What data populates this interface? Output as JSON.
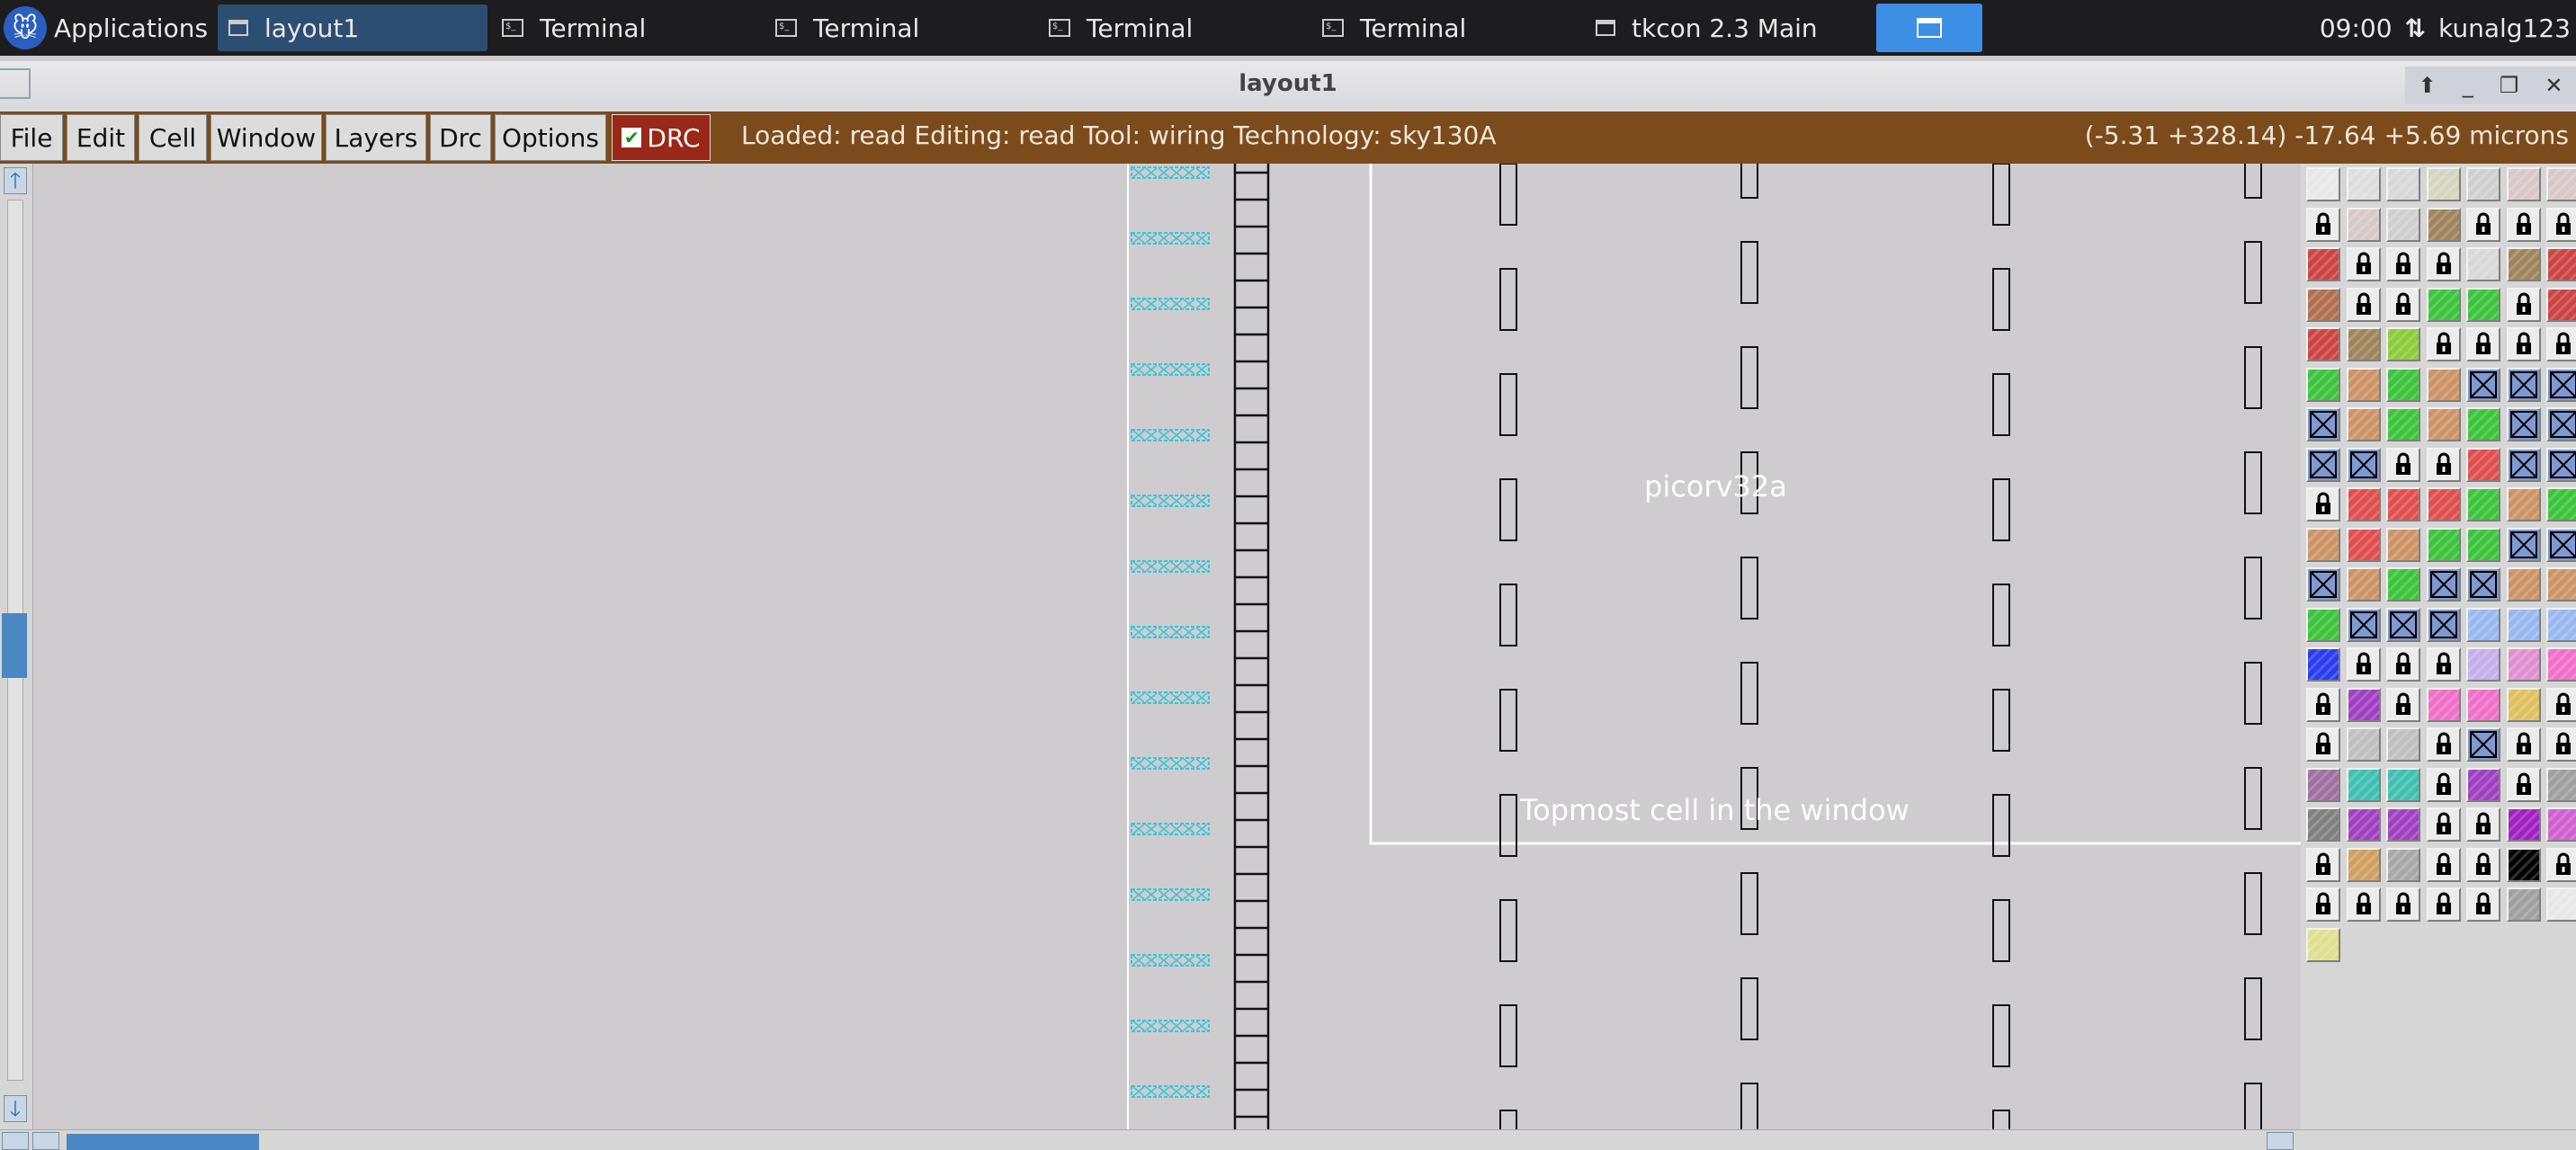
{
  "taskbar": {
    "apps_label": "Applications",
    "tasks": [
      {
        "label": "layout1",
        "icon": "window-icon",
        "active": true
      },
      {
        "label": "Terminal",
        "icon": "terminal-icon",
        "active": false
      },
      {
        "label": "Terminal",
        "icon": "terminal-icon",
        "active": false
      },
      {
        "label": "Terminal",
        "icon": "terminal-icon",
        "active": false
      },
      {
        "label": "Terminal",
        "icon": "terminal-icon",
        "active": false
      },
      {
        "label": "tkcon 2.3 Main",
        "icon": "window-icon",
        "active": false
      }
    ],
    "clock": "09:00",
    "network_icon": "network-updown-icon",
    "user": "kunalg123"
  },
  "window": {
    "title": "layout1",
    "controls": [
      "up-icon",
      "minimize-icon",
      "restore-icon",
      "close-icon"
    ]
  },
  "menubar": {
    "items": [
      "File",
      "Edit",
      "Cell",
      "Window",
      "Layers",
      "Drc",
      "Options"
    ],
    "drc_label": "DRC",
    "drc_checked": true,
    "status": "Loaded: read  Editing: read  Tool: wiring   Technology: sky130A",
    "coords": "(-5.31 +328.14) -17.64 +5.69 microns"
  },
  "canvas": {
    "cell_name": "picorv32a",
    "box_label": "Topmost cell in the window",
    "background": "#cfcccf"
  },
  "palette": {
    "rows": [
      [
        "#e8e8e8g",
        "#dededeY",
        "#d8d8d8F",
        "#d6d6c0",
        "#cfcfcfH",
        "#d8c8c8",
        "#d8c8c8"
      ],
      [
        "L",
        "#d8c8c8",
        "#cfcfcfH",
        "#a0845c",
        "L",
        "L",
        "L"
      ],
      [
        "#cc4444",
        "L",
        "L",
        "L",
        "#d8d8d8",
        "#a0845c",
        "#cc4444"
      ],
      [
        "#b07050",
        "L",
        "L",
        "#3cc43c",
        "#3cc43c",
        "L",
        "#cc4444"
      ],
      [
        "#cc4444",
        "#a0845c",
        "#8ccc3c",
        "L",
        "L",
        "L",
        "L"
      ],
      [
        "#3cc43c",
        "#cc9466",
        "#3cc43c",
        "#cc9466",
        "X",
        "X",
        "X"
      ],
      [
        "X",
        "#cc9466",
        "#3cc43c",
        "#cc9466",
        "#3cc43c",
        "X",
        "X"
      ],
      [
        "X",
        "X",
        "L",
        "L",
        "#e04e4e",
        "X",
        "X"
      ],
      [
        "L",
        "#e04e4e",
        "#e04e4e",
        "#e04e4e",
        "#3cc43c",
        "#cc9466",
        "#3cc43c"
      ],
      [
        "#cc9466",
        "#e04e4e",
        "#cc9466",
        "#3cc43c",
        "#3cc43c",
        "X",
        "X"
      ],
      [
        "X",
        "#cc9466",
        "#3cc43c",
        "X",
        "X",
        "#cc9466",
        "#cc9466"
      ],
      [
        "#3cc43c",
        "X",
        "X",
        "X",
        "#9ab8f0",
        "#9ab8f0",
        "#9ab8f0"
      ],
      [
        "#2a3cf0",
        "L",
        "L",
        "L",
        "#c4b0e8",
        "#e090d0",
        "#f070c8"
      ],
      [
        "L",
        "#a040c0",
        "L",
        "#f070c8",
        "#f070c8",
        "#e0c060",
        "L"
      ],
      [
        "L",
        "#c0c0c0",
        "#c0c0c0",
        "L",
        "X",
        "L",
        "L"
      ],
      [
        "#a070a0",
        "#40c0b0",
        "#40c0b0",
        "L",
        "#a040c0",
        "L",
        "#a0a0a0"
      ],
      [
        "#808080",
        "#a040c0",
        "#a040c0",
        "L",
        "L",
        "#a020c0",
        "#d060d0"
      ],
      [
        "L",
        "#d0a060",
        "#a8a8a8",
        "L",
        "L",
        "#000000",
        "L"
      ],
      [
        "L",
        "L",
        "L",
        "L",
        "L",
        "#a0a0a0",
        "#e8e8e8"
      ],
      [
        "#e0e090"
      ]
    ]
  }
}
